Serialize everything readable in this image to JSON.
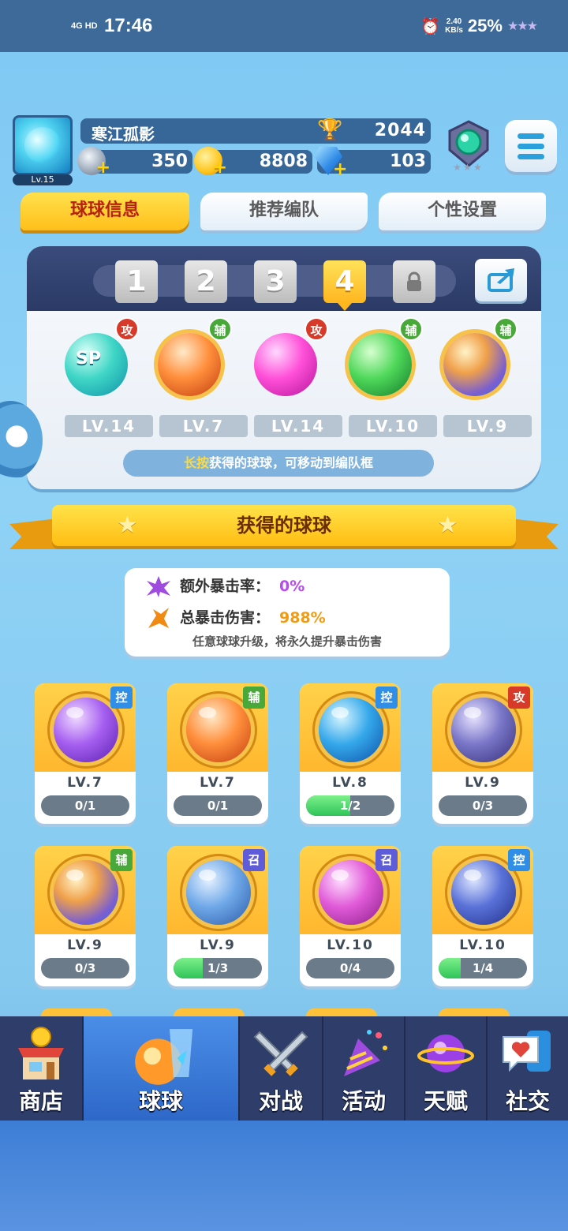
{
  "status": {
    "network": "4G HD",
    "time": "17:46",
    "speed": "2.40",
    "speed_unit": "KB/s",
    "battery": "25%"
  },
  "player": {
    "name": "寒江孤影",
    "level": "Lv.15",
    "trophies": "2044",
    "res_1": "350",
    "res_2": "8808",
    "res_3": "103"
  },
  "tabs": [
    {
      "label": "球球信息",
      "active": true
    },
    {
      "label": "推荐编队",
      "active": false
    },
    {
      "label": "个性设置",
      "active": false
    }
  ],
  "team": {
    "slots": [
      "1",
      "2",
      "3",
      "4"
    ],
    "active_slot": "4",
    "balls": [
      {
        "level": "LV.14",
        "badge": "攻",
        "icon": "sp-sword-ball"
      },
      {
        "level": "LV.7",
        "badge": "辅",
        "icon": "wing-ball"
      },
      {
        "level": "LV.14",
        "badge": "攻",
        "icon": "shield-bolt-ball"
      },
      {
        "level": "LV.10",
        "badge": "辅",
        "icon": "arrow-up-ball"
      },
      {
        "level": "LV.9",
        "badge": "辅",
        "icon": "clone-ball"
      }
    ],
    "hint_highlight": "长按",
    "hint_rest": "获得的球球，可移动到编队框"
  },
  "section_title": "获得的球球",
  "crit": {
    "extra_label": "额外暴击率：",
    "extra_value": "0%",
    "total_label": "总暴击伤害：",
    "total_value": "988%",
    "note": "任意球球升级，将永久提升暴击伤害"
  },
  "cards": [
    {
      "level": "LV.7",
      "progress": "0/1",
      "fill": 0,
      "type": "控",
      "icon": "butterfly-ball"
    },
    {
      "level": "LV.7",
      "progress": "0/1",
      "fill": 0,
      "type": "辅",
      "icon": "wing-ball"
    },
    {
      "level": "LV.8",
      "progress": "1/2",
      "fill": 0.5,
      "type": "控",
      "icon": "wave-ball"
    },
    {
      "level": "LV.9",
      "progress": "0/3",
      "fill": 0,
      "type": "攻",
      "icon": "pixel-ball"
    },
    {
      "level": "LV.9",
      "progress": "0/3",
      "fill": 0,
      "type": "辅",
      "icon": "clone-ball"
    },
    {
      "level": "LV.9",
      "progress": "1/3",
      "fill": 0.333,
      "type": "召",
      "icon": "vortex-ball"
    },
    {
      "level": "LV.10",
      "progress": "0/4",
      "fill": 0,
      "type": "召",
      "icon": "mushroom-ball"
    },
    {
      "level": "LV.10",
      "progress": "1/4",
      "fill": 0.25,
      "type": "控",
      "icon": "clock-ball"
    }
  ],
  "nav": [
    {
      "label": "商店",
      "icon": "shop-icon"
    },
    {
      "label": "球球",
      "icon": "ball-icon",
      "active": true
    },
    {
      "label": "对战",
      "icon": "swords-icon"
    },
    {
      "label": "活动",
      "icon": "party-icon"
    },
    {
      "label": "天赋",
      "icon": "planet-icon"
    },
    {
      "label": "社交",
      "icon": "social-icon"
    }
  ],
  "colors": {
    "accent_yellow": "#ffbf1a",
    "nav_bg": "#2f3d6b",
    "attack": "#d83a2a",
    "support": "#48a83a",
    "control": "#2f8ee8",
    "summon": "#5e5cd9"
  }
}
